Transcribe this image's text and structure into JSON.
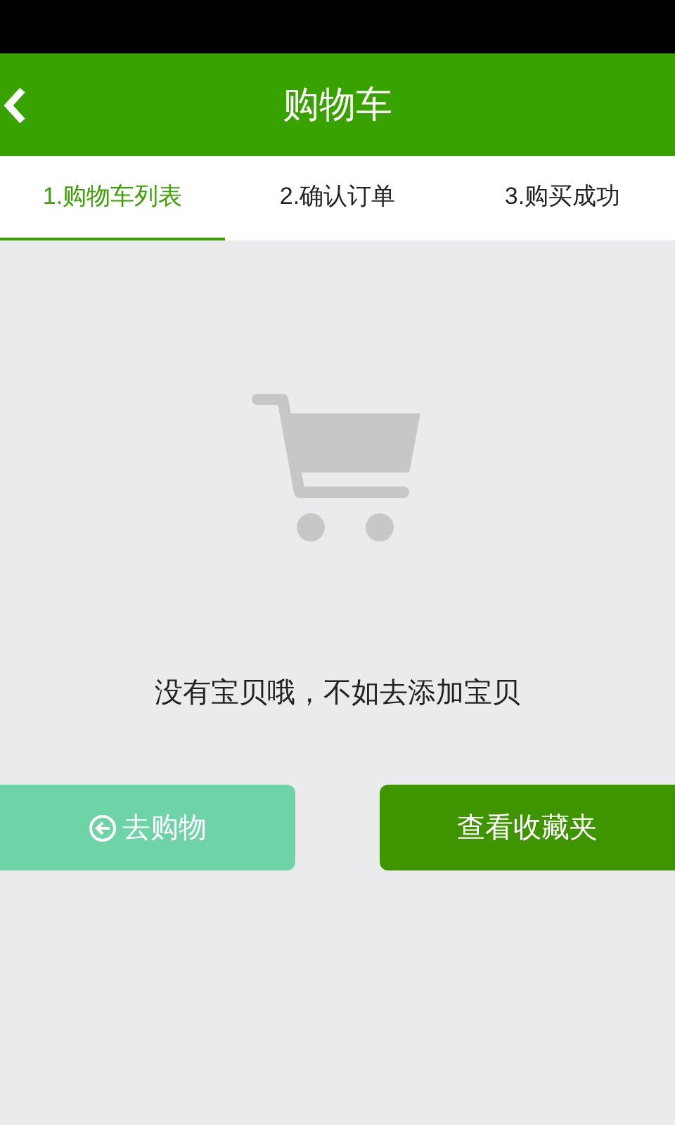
{
  "header": {
    "title": "购物车"
  },
  "tabs": [
    {
      "label": "1.购物车列表",
      "selected": true
    },
    {
      "label": "2.确认订单",
      "selected": false
    },
    {
      "label": "3.购买成功",
      "selected": false
    }
  ],
  "empty_state": {
    "message": "没有宝贝哦，不如去添加宝贝"
  },
  "buttons": [
    {
      "label": "去购物",
      "kind": "back"
    },
    {
      "label": "查看收藏夹",
      "kind": "primary"
    }
  ]
}
